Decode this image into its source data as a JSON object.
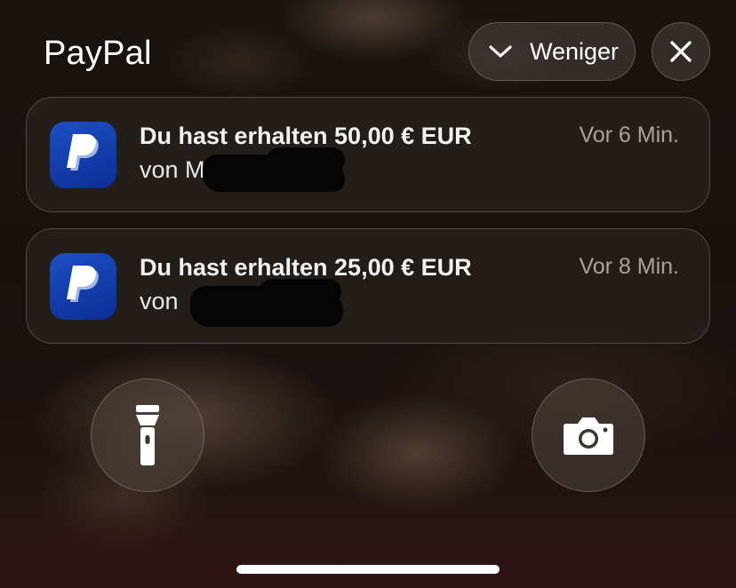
{
  "header": {
    "app_title": "PayPal",
    "less_label": "Weniger",
    "less_icon": "chevron-down-icon",
    "close_icon": "close-icon"
  },
  "notifications": [
    {
      "app_icon": "paypal-icon",
      "title": "Du hast erhalten 50,00 € EUR",
      "body": "von M",
      "time": "Vor 6 Min."
    },
    {
      "app_icon": "paypal-icon",
      "title": "Du hast erhalten 25,00 € EUR",
      "body": "von",
      "time": "Vor 8 Min."
    }
  ],
  "quick_actions": {
    "left_icon": "flashlight-icon",
    "right_icon": "camera-icon"
  },
  "colors": {
    "paypal_blue": "#1d4fc4",
    "paypal_light_blue": "#cfe0ff",
    "text_secondary": "#a9a39f"
  }
}
